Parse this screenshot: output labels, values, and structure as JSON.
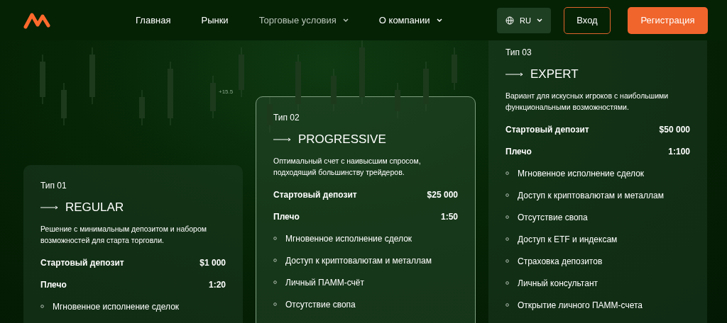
{
  "nav": {
    "items": [
      {
        "label": "Главная",
        "selected": false,
        "dropdown": false
      },
      {
        "label": "Рынки",
        "selected": false,
        "dropdown": false
      },
      {
        "label": "Торговые условия",
        "selected": true,
        "dropdown": true
      },
      {
        "label": "О компании",
        "selected": false,
        "dropdown": true
      }
    ],
    "language": "RU",
    "login": "Вход",
    "register": "Регистрация"
  },
  "ticker": "+15.5",
  "cards": [
    {
      "type": "Тип 01",
      "name": "REGULAR",
      "highlighted": false,
      "description": "Решение с минимальным депозитом и набором возможностей для старта торговли.",
      "specs": [
        {
          "label": "Стартовый депозит",
          "value": "$1 000"
        },
        {
          "label": "Плечо",
          "value": "1:20"
        }
      ],
      "features": [
        "Мгновенное исполнение сделок"
      ]
    },
    {
      "type": "Тип 02",
      "name": "PROGRESSIVE",
      "highlighted": true,
      "description": "Оптимальный счет с наивысшим спросом, подходящий большинству трейдеров.",
      "specs": [
        {
          "label": "Стартовый депозит",
          "value": "$25 000"
        },
        {
          "label": "Плечо",
          "value": "1:50"
        }
      ],
      "features": [
        "Мгновенное исполнение сделок",
        "Доступ к криптовалютам и металлам",
        "Личный ПАММ-счёт",
        "Отсутствие свопа"
      ]
    },
    {
      "type": "Тип 03",
      "name": "EXPERT",
      "highlighted": false,
      "description": "Вариант для искусных игроков с наибольшими функциональными возможностями.",
      "specs": [
        {
          "label": "Стартовый депозит",
          "value": "$50 000"
        },
        {
          "label": "Плечо",
          "value": "1:100"
        }
      ],
      "features": [
        "Мгновенное исполнение сделок",
        "Доступ к криптовалютам и металлам",
        "Отсутствие свопа",
        "Доступ к ETF и индексам",
        "Страховка депозитов",
        "Личный консультант",
        "Открытие личного ПАММ-счета"
      ]
    }
  ]
}
